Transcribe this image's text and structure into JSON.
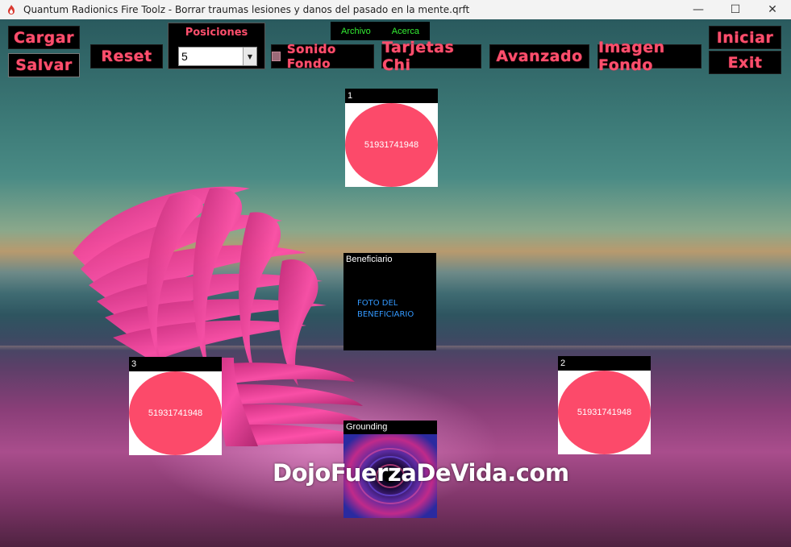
{
  "window": {
    "title": "Quantum Radionics Fire Toolz - Borrar traumas lesiones y danos del pasado en la mente.qrft",
    "controls": {
      "minimize": "—",
      "maximize": "☐",
      "close": "✕"
    }
  },
  "toolbar": {
    "cargar": "Cargar",
    "salvar": "Salvar",
    "reset": "Reset",
    "posiciones_label": "Posiciones",
    "posiciones_value": "5",
    "sonido_fondo": "Sonido Fondo",
    "tarjetas_chi": "Tarjetas Chi",
    "avanzado": "Avanzado",
    "imagen_fondo": "Imagen Fondo",
    "iniciar": "Iniciar",
    "exit": "Exit"
  },
  "menu": {
    "archivo": "Archivo",
    "acerca": "Acerca"
  },
  "panels": {
    "p1": {
      "label": "1",
      "value": "51931741948"
    },
    "p2": {
      "label": "2",
      "value": "51931741948"
    },
    "p3": {
      "label": "3",
      "value": "51931741948"
    },
    "beneficiario": {
      "label": "Beneficiario",
      "foto_line1": "FOTO DEL",
      "foto_line2": "BENEFICIARIO"
    },
    "grounding": {
      "label": "Grounding"
    }
  },
  "watermark": "DojoFuerzaDeVida.com",
  "colors": {
    "accent": "#ff4f6d",
    "menu_text": "#33ee33",
    "circle": "#fc4a6a",
    "foto_text": "#3399ff"
  }
}
